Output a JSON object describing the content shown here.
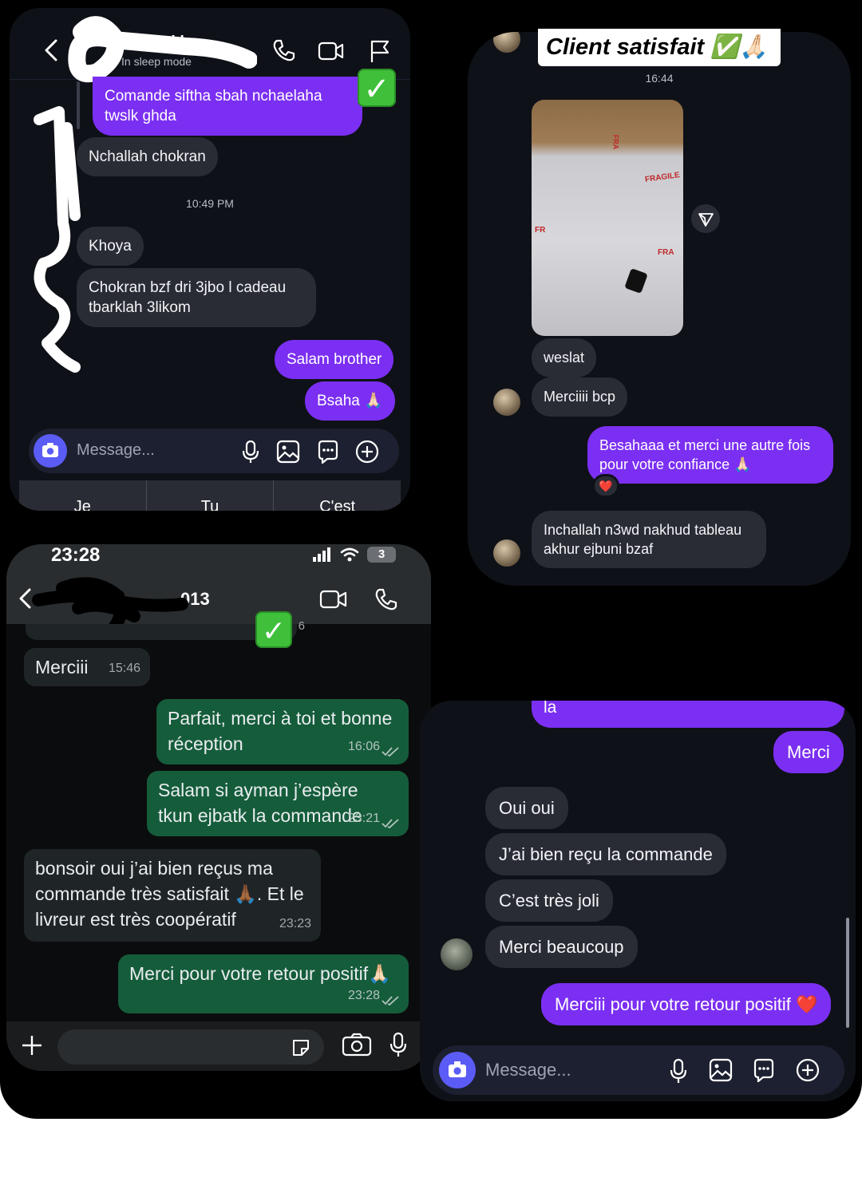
{
  "overlay": {
    "title": "Client satisfait ✅🙏🏻"
  },
  "top_left": {
    "header": {
      "name": "Ahmed l",
      "status": "In sleep mode"
    },
    "messages": [
      {
        "dir": "out",
        "text": "Comande siftha sbah nchaelaha twslk ghda"
      },
      {
        "dir": "in",
        "text": "Nchallah chokran"
      },
      {
        "dir": "ts",
        "text": "10:49 PM"
      },
      {
        "dir": "in",
        "text": "Khoya"
      },
      {
        "dir": "in",
        "text": "Chokran bzf dri 3jbo l cadeau tbarklah 3likom"
      },
      {
        "dir": "out",
        "text": "Salam brother"
      },
      {
        "dir": "out",
        "text": "Bsaha 🙏🏻"
      }
    ],
    "composer": {
      "placeholder": "Message..."
    },
    "suggestions": [
      "Je",
      "Tu",
      "C'est"
    ]
  },
  "top_right": {
    "time": "16:44",
    "messages": [
      {
        "dir": "in",
        "text": "weslat"
      },
      {
        "dir": "in",
        "text": "Merciiii bcp"
      },
      {
        "dir": "out",
        "text": "Besahaaa et merci une autre fois pour votre confiance 🙏🏻"
      },
      {
        "dir": "in",
        "text": "Inchallah n3wd nakhud tableau akhur ejbuni bzaf"
      }
    ],
    "reaction": "❤️",
    "photo_labels": [
      "FRAGILE",
      "FRA",
      "FR",
      "FRA"
    ]
  },
  "bottom_left": {
    "status_bar": {
      "time": "23:28",
      "battery": "3"
    },
    "header": {
      "name_suffix": "013",
      "partial": "6"
    },
    "messages": [
      {
        "dir": "in",
        "text": "Merciii",
        "time": "15:46"
      },
      {
        "dir": "out",
        "text": "Parfait, merci à toi et bonne réception",
        "time": "16:06"
      },
      {
        "dir": "out",
        "text": "Salam si ayman j’espère tkun ejbatk la commande",
        "time": "23:21"
      },
      {
        "dir": "in",
        "text": "bonsoir oui j’ai bien reçus ma commande très satisfait 🙏🏾. Et le livreur est très coopératif",
        "time": "23:23"
      },
      {
        "dir": "out",
        "text": "Merci pour votre retour positif🙏🏻",
        "time": "23:28"
      }
    ]
  },
  "bottom_right": {
    "messages": [
      {
        "dir": "out",
        "text": "la"
      },
      {
        "dir": "out",
        "text": "Merci"
      },
      {
        "dir": "in",
        "text": "Oui oui"
      },
      {
        "dir": "in",
        "text": "J’ai bien reçu la commande"
      },
      {
        "dir": "in",
        "text": "C’est très joli"
      },
      {
        "dir": "in",
        "text": "Merci beaucoup"
      },
      {
        "dir": "out",
        "text": "Merciii pour votre retour positif ❤️"
      }
    ],
    "composer": {
      "placeholder": "Message..."
    }
  },
  "colors": {
    "ig_background": "#0f1118",
    "ig_outgoing": "#7b2ff2",
    "ig_incoming": "#2a2c35",
    "wa_outgoing": "#155c3b",
    "wa_incoming": "#1f2427"
  }
}
